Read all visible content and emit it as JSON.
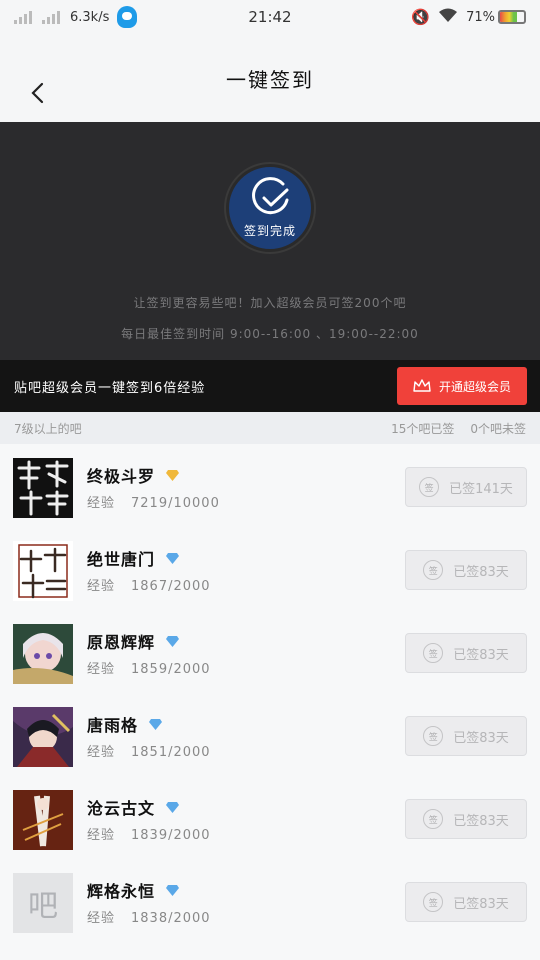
{
  "status_bar": {
    "net_speed": "6.3k/s",
    "time": "21:42",
    "battery": "71%",
    "battery_level": 0.71
  },
  "header": {
    "title": "一键签到"
  },
  "hero": {
    "badge_label": "签到完成",
    "line1": "让签到更容易些吧！加入超级会员可签200个吧",
    "line2": "每日最佳签到时间 9:00--16:00 、19:00--22:00"
  },
  "promo": {
    "text": "贴吧超级会员一键签到6倍经验",
    "button_label": "开通超级会员"
  },
  "list_header": {
    "left": "7级以上的吧",
    "signed_count": "15个吧已签",
    "unsigned_count": "0个吧未签"
  },
  "forums": [
    {
      "name": "终极斗罗",
      "exp_label": "经验",
      "exp": "7219/10000",
      "badge": "gold",
      "button": "已签141天",
      "sign_icon": "签"
    },
    {
      "name": "绝世唐门",
      "exp_label": "经验",
      "exp": "1867/2000",
      "badge": "blue",
      "button": "已签83天",
      "sign_icon": "签"
    },
    {
      "name": "原恩辉辉",
      "exp_label": "经验",
      "exp": "1859/2000",
      "badge": "blue",
      "button": "已签83天",
      "sign_icon": "签"
    },
    {
      "name": "唐雨格",
      "exp_label": "经验",
      "exp": "1851/2000",
      "badge": "blue",
      "button": "已签83天",
      "sign_icon": "签"
    },
    {
      "name": "沧云古文",
      "exp_label": "经验",
      "exp": "1839/2000",
      "badge": "blue",
      "button": "已签83天",
      "sign_icon": "签"
    },
    {
      "name": "辉格永恒",
      "exp_label": "经验",
      "exp": "1838/2000",
      "badge": "blue",
      "button": "已签83天",
      "sign_icon": "签",
      "avatar_text": "吧"
    }
  ],
  "colors": {
    "accent_red": "#f0413a",
    "hero_bg": "#2b2b2d",
    "badge_blue": "#1d3f78"
  }
}
